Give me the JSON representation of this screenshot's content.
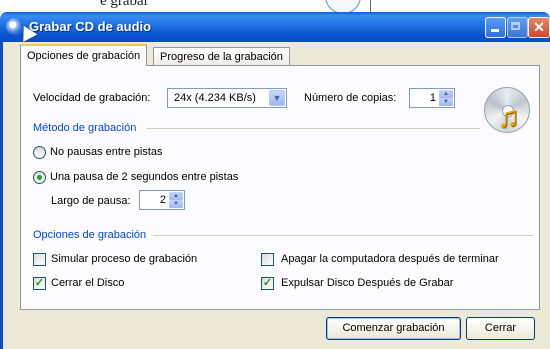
{
  "window": {
    "title": "Grabar CD de audio",
    "close_glyph": "✕"
  },
  "background": {
    "partial_text": "e grabar"
  },
  "tabs": [
    {
      "label": "Opciones de grabación",
      "active": true
    },
    {
      "label": "Progreso de la grabación",
      "active": false
    }
  ],
  "speed": {
    "label": "Velocidad de grabación:",
    "value": "24x (4.234 KB/s)"
  },
  "copies": {
    "label": "Número de copias:",
    "value": "1"
  },
  "method": {
    "section": "Método de grabación",
    "option_no_pause": "No pausas entre pistas",
    "option_pause": "Una pausa de 2 segundos entre pistas",
    "selected": "option_pause",
    "pause_length_label": "Largo de pausa:",
    "pause_length_value": "2"
  },
  "options": {
    "section": "Opciones de grabación",
    "simulate": {
      "label": "Simular proceso de grabación",
      "checked": false
    },
    "shutdown": {
      "label": "Apagar la computadora después de terminar",
      "checked": false
    },
    "close_disc": {
      "label": "Cerrar el Disco",
      "checked": true
    },
    "eject": {
      "label": "Expulsar Disco Después de Grabar",
      "checked": true
    }
  },
  "buttons": {
    "start": "Comenzar grabación",
    "close": "Cerrar"
  },
  "icons": {
    "app": "cd-audio-icon",
    "disc": "music-disc-icon"
  },
  "colors": {
    "titlebar": "#0a4cc4",
    "section_text": "#0046d5",
    "check": "#21a121"
  }
}
